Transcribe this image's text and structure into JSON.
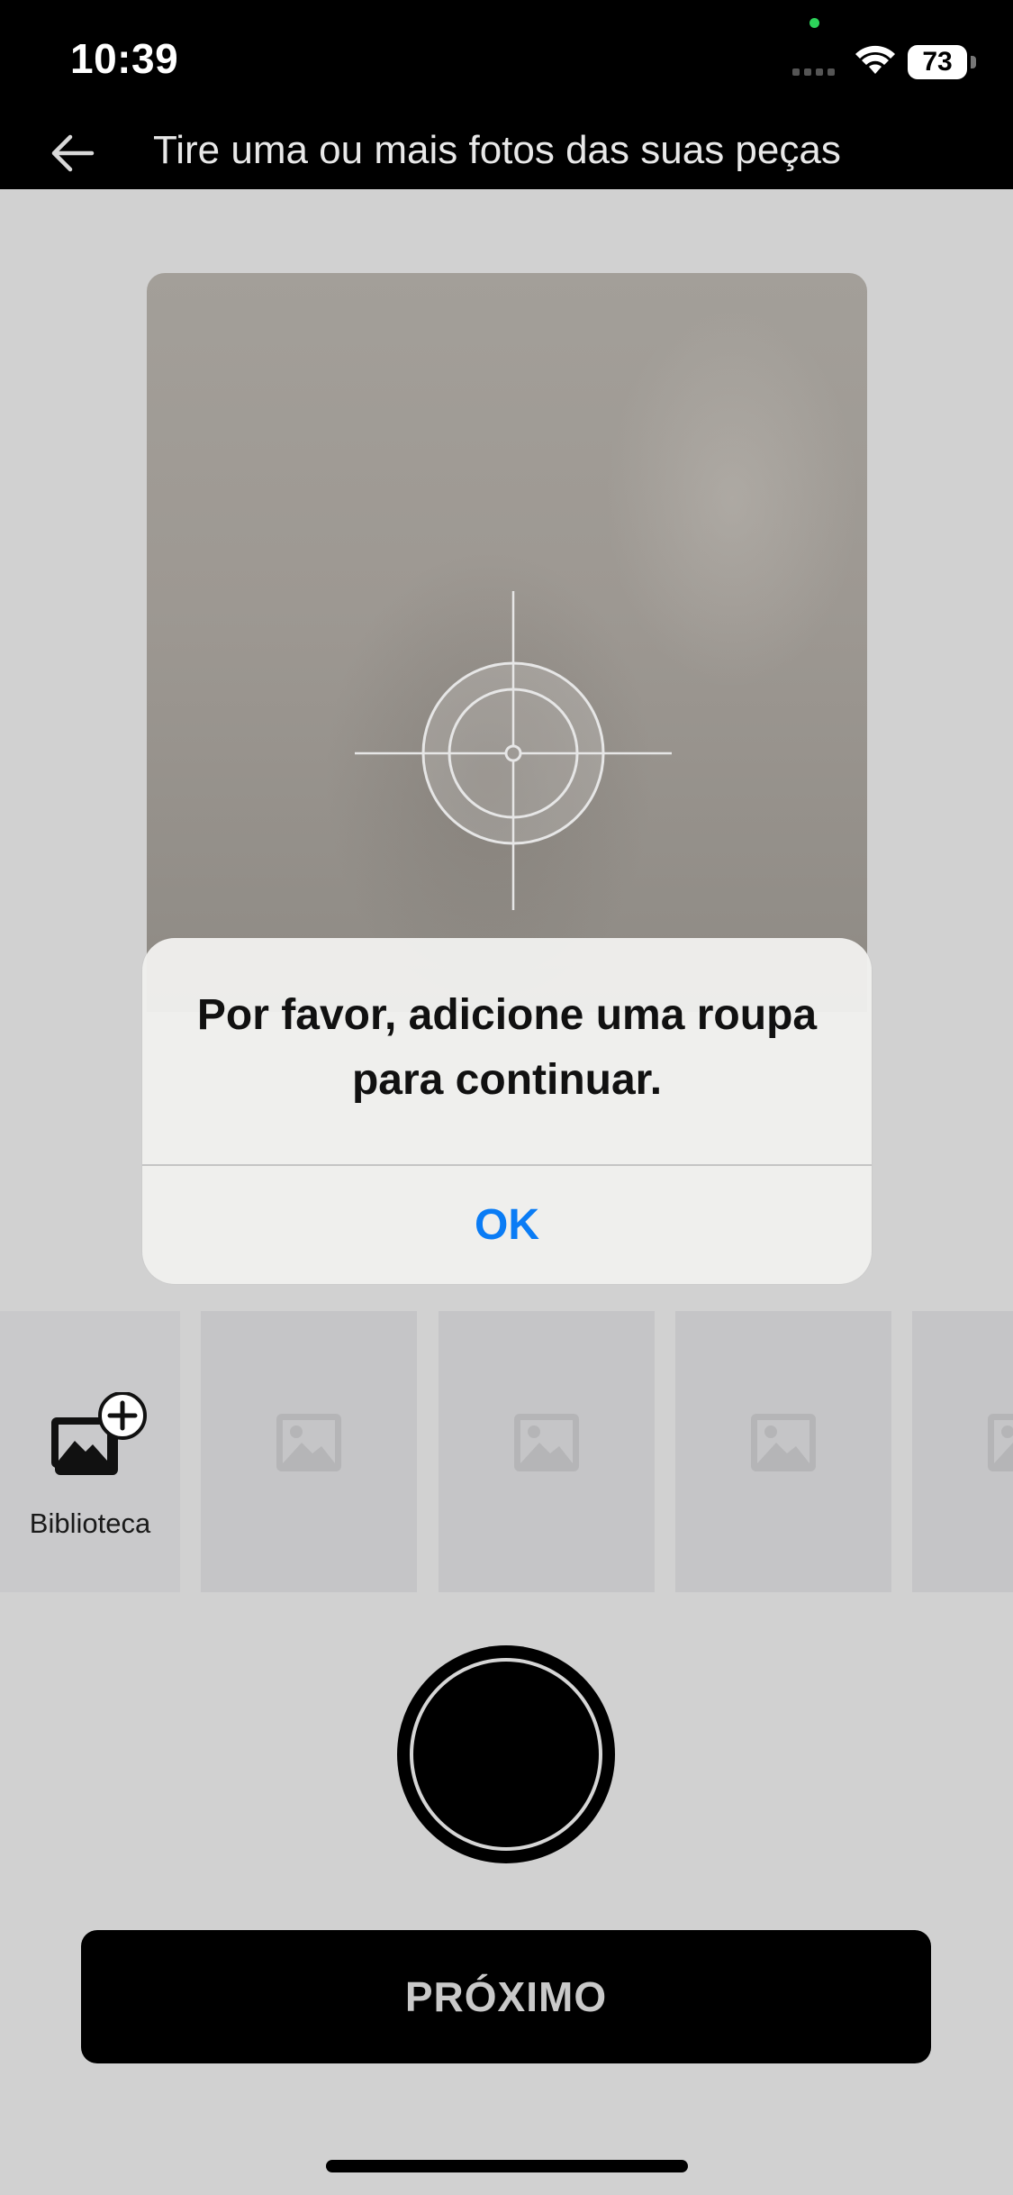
{
  "status_bar": {
    "time": "10:39",
    "battery_level": "73",
    "indicator_color": "#2dd35a"
  },
  "header": {
    "back_icon": "arrow-left-icon",
    "title": "Tire uma ou mais fotos das suas peças"
  },
  "camera": {
    "reticle_icon": "focus-crosshair-icon"
  },
  "alert": {
    "message": "Por favor, adicione uma roupa para continuar.",
    "ok_label": "OK",
    "ok_color": "#0a7cf5"
  },
  "thumbnails": {
    "library_label": "Biblioteca",
    "library_icon": "add-photo-icon",
    "slot_icon": "image-placeholder-icon",
    "slots": 4
  },
  "shutter": {
    "icon": "shutter-button"
  },
  "next_button": {
    "label": "PRÓXIMO"
  }
}
